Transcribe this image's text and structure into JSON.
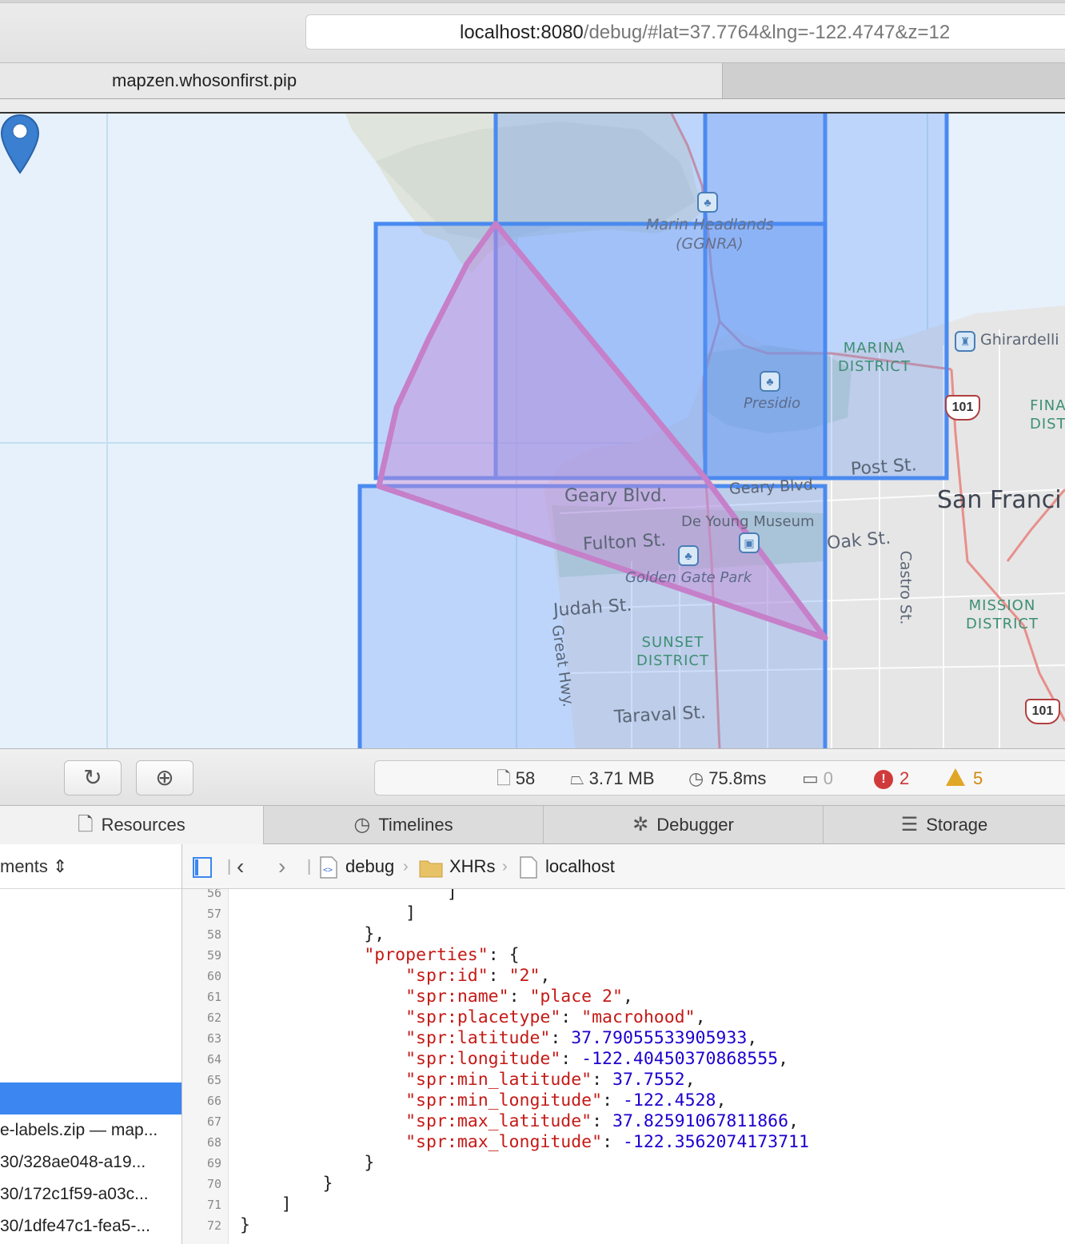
{
  "browser": {
    "address_host": "localhost:8080",
    "address_path": "/debug/#lat=37.7764&lng=-122.4747&z=12",
    "tab_title": "mapzen.whosonfirst.pip"
  },
  "map": {
    "labels": {
      "marin_headlands": "Marin Headlands",
      "ggnra": "(GGNRA)",
      "marina_district": "MARINA\nDISTRICT",
      "ghirardelli": "Ghirardelli S",
      "fina_dist": "FINA\nDIST",
      "presidio": "Presidio",
      "post_st": "Post St.",
      "san_francisco": "San Franci",
      "geary_blvd_west": "Geary Blvd.",
      "geary_blvd_east": "Geary Blvd.",
      "de_young": "De Young Museum",
      "fulton_st": "Fulton St.",
      "oak_st": "Oak St.",
      "castro_st": "Castro St.",
      "golden_gate_park": "Golden Gate Park",
      "judah_st": "Judah St.",
      "mission_district": "MISSION\nDISTRICT",
      "sunset_district": "SUNSET\nDISTRICT",
      "great_hwy": "Great Hwy.",
      "taraval_st": "Taraval St.",
      "hwy_101_a": "101",
      "hwy_101_b": "101"
    }
  },
  "toolbar": {
    "reload_icon": "reload-icon",
    "download_icon": "download-icon",
    "resources_count": "58",
    "size": "3.71 MB",
    "time": "75.8ms",
    "logs": "0",
    "errors": "2",
    "warnings": "5"
  },
  "tabs": [
    {
      "label": "Resources",
      "icon": "document-icon"
    },
    {
      "label": "Timelines",
      "icon": "clock-icon"
    },
    {
      "label": "Debugger",
      "icon": "bug-icon"
    },
    {
      "label": "Storage",
      "icon": "database-icon"
    }
  ],
  "sidebar": {
    "header": "ments",
    "rows": [
      "e-labels.zip — map...",
      "30/328ae048-a19...",
      "30/172c1f59-a03c...",
      "30/1dfe47c1-fea5-..."
    ]
  },
  "breadcrumb": [
    "debug",
    "XHRs",
    "localhost"
  ],
  "code": {
    "line_numbers": [
      "56",
      "57",
      "58",
      "59",
      "60",
      "61",
      "62",
      "63",
      "64",
      "65",
      "66",
      "67",
      "68",
      "69",
      "70",
      "71",
      "72"
    ],
    "lines": [
      "                    ]",
      "                ]",
      "            },",
      "            \"properties\": {",
      "                \"spr:id\": \"2\",",
      "                \"spr:name\": \"place 2\",",
      "                \"spr:placetype\": \"macrohood\",",
      "                \"spr:latitude\": 37.79055533905933,",
      "                \"spr:longitude\": -122.40450370868555,",
      "                \"spr:min_latitude\": 37.7552,",
      "                \"spr:min_longitude\": -122.4528,",
      "                \"spr:max_latitude\": 37.82591067811866,",
      "                \"spr:max_longitude\": -122.3562074173711",
      "            }",
      "        }",
      "    ]",
      "}"
    ]
  },
  "colors": {
    "bbox_stroke": "#4a8af0",
    "bbox_fill": "#5f96f5",
    "polygon_stroke": "#c67fc9",
    "selected_row": "#3b86f0"
  }
}
